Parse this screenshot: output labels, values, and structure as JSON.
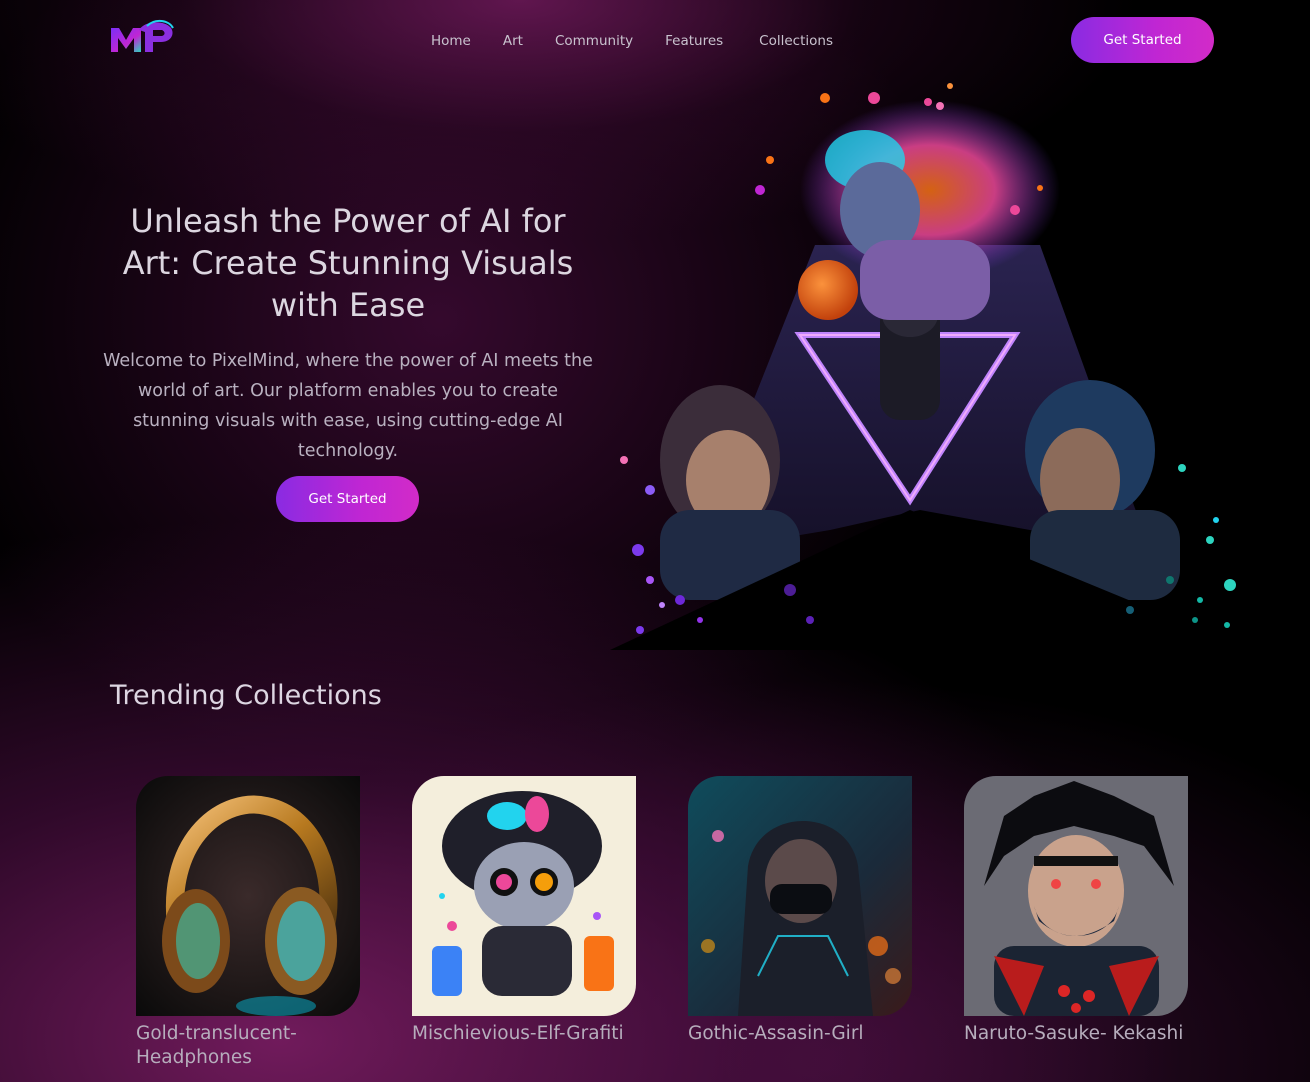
{
  "nav": {
    "logo_text": "MP",
    "links": [
      "Home",
      "Art",
      "Community",
      "Features",
      "Collections"
    ],
    "cta_label": "Get Started"
  },
  "hero": {
    "title": "Unleash the Power of AI for Art: Create Stunning Visuals with Ease",
    "description": "Welcome to PixelMind, where the power of AI meets the world of art. Our platform enables you to create stunning visuals with ease, using cutting-edge AI technology.",
    "cta_label": "Get Started"
  },
  "trending": {
    "title": "Trending Collections",
    "items": [
      {
        "label": "Gold-translucent-Headphones"
      },
      {
        "label": "Mischievious-Elf-Grafiti"
      },
      {
        "label": "Gothic-Assasin-Girl"
      },
      {
        "label": "Naruto-Sasuke- Kekashi"
      }
    ]
  },
  "colors": {
    "accent_start": "#8a2be2",
    "accent_end": "#d22bc8",
    "background": "#000000",
    "glow": "#6e195a"
  }
}
